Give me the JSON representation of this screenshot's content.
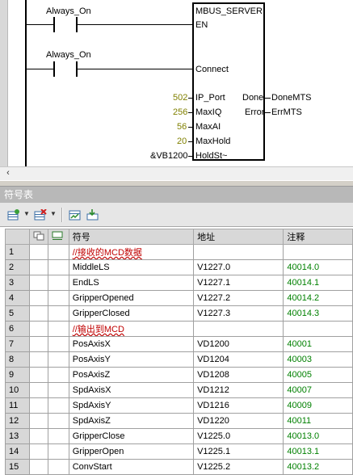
{
  "ladder": {
    "contacts": [
      {
        "label": "Always_On",
        "connects_to": "EN"
      },
      {
        "label": "Always_On",
        "connects_to": "Connect"
      }
    ],
    "block": {
      "title": "MBUS_SERVER",
      "inputs": [
        {
          "name": "EN",
          "value": ""
        },
        {
          "name": "Connect",
          "value": ""
        },
        {
          "name": "IP_Port",
          "value": "502"
        },
        {
          "name": "MaxIQ",
          "value": "256"
        },
        {
          "name": "MaxAI",
          "value": "56"
        },
        {
          "name": "MaxHold",
          "value": "20"
        },
        {
          "name": "HoldSt~",
          "value": "&VB1200"
        }
      ],
      "outputs": [
        {
          "name": "Done",
          "value": "DoneMTS"
        },
        {
          "name": "Error",
          "value": "ErrMTS"
        }
      ]
    },
    "scroll_left_icon": "‹"
  },
  "panel": {
    "title": "符号表",
    "toolbar_icons": [
      "insert-row-icon",
      "delete-row-icon",
      "create-symbols-icon",
      "apply-symbols-icon"
    ]
  },
  "table": {
    "columns": [
      "",
      "",
      "",
      "符号",
      "地址",
      "注释"
    ],
    "rows": [
      {
        "n": "1",
        "symbol": "//接收的MCD数据",
        "address": "",
        "comment": "",
        "group": true
      },
      {
        "n": "2",
        "symbol": "MiddleLS",
        "address": "V1227.0",
        "comment": "40014.0"
      },
      {
        "n": "3",
        "symbol": "EndLS",
        "address": "V1227.1",
        "comment": "40014.1"
      },
      {
        "n": "4",
        "symbol": "GripperOpened",
        "address": "V1227.2",
        "comment": "40014.2"
      },
      {
        "n": "5",
        "symbol": "GripperClosed",
        "address": "V1227.3",
        "comment": "40014.3"
      },
      {
        "n": "6",
        "symbol": "//输出到MCD",
        "address": "",
        "comment": "",
        "group": true
      },
      {
        "n": "7",
        "symbol": "PosAxisX",
        "address": "VD1200",
        "comment": "40001"
      },
      {
        "n": "8",
        "symbol": "PosAxisY",
        "address": "VD1204",
        "comment": "40003"
      },
      {
        "n": "9",
        "symbol": "PosAxisZ",
        "address": "VD1208",
        "comment": "40005"
      },
      {
        "n": "10",
        "symbol": "SpdAxisX",
        "address": "VD1212",
        "comment": "40007"
      },
      {
        "n": "11",
        "symbol": "SpdAxisY",
        "address": "VD1216",
        "comment": "40009"
      },
      {
        "n": "12",
        "symbol": "SpdAxisZ",
        "address": "VD1220",
        "comment": "40011"
      },
      {
        "n": "13",
        "symbol": "GripperClose",
        "address": "V1225.0",
        "comment": "40013.0"
      },
      {
        "n": "14",
        "symbol": "GripperOpen",
        "address": "V1225.1",
        "comment": "40013.1"
      },
      {
        "n": "15",
        "symbol": "ConvStart",
        "address": "V1225.2",
        "comment": "40013.2"
      }
    ]
  }
}
